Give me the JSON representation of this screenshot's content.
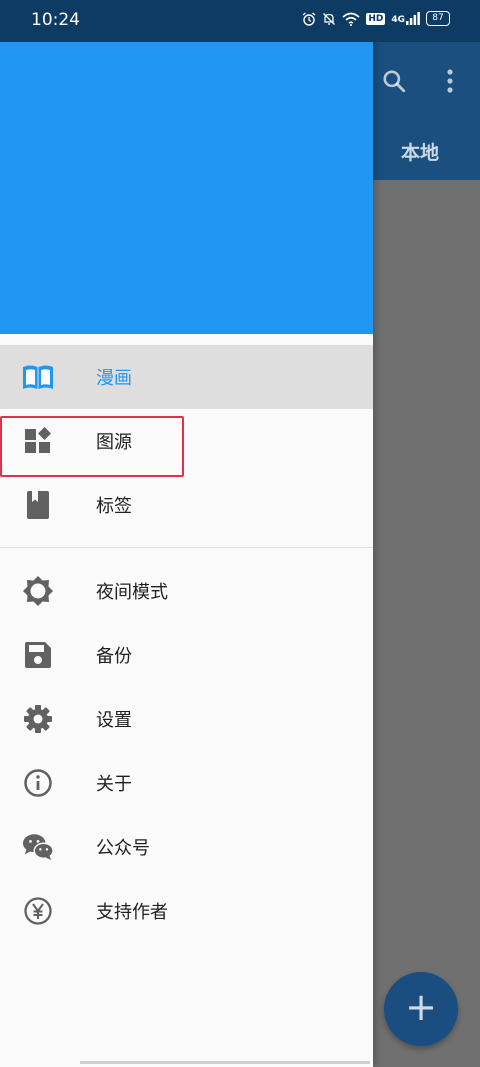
{
  "status_bar": {
    "time": "10:24",
    "hd": "HD",
    "network": "4G",
    "battery": "87"
  },
  "toolbar": {
    "tab_local": "本地"
  },
  "drawer": {
    "items": [
      {
        "label": "漫画",
        "icon": "book-icon",
        "active": true
      },
      {
        "label": "图源",
        "icon": "widgets-icon"
      },
      {
        "label": "标签",
        "icon": "bookmark-icon"
      },
      {
        "label": "夜间模式",
        "icon": "brightness-icon"
      },
      {
        "label": "备份",
        "icon": "save-icon"
      },
      {
        "label": "设置",
        "icon": "gear-icon"
      },
      {
        "label": "关于",
        "icon": "info-icon"
      },
      {
        "label": "公众号",
        "icon": "wechat-icon"
      },
      {
        "label": "支持作者",
        "icon": "yen-icon"
      }
    ]
  },
  "colors": {
    "accent": "#2196f3",
    "highlight": "#e0304a",
    "status_bar": "#0e3b63"
  }
}
